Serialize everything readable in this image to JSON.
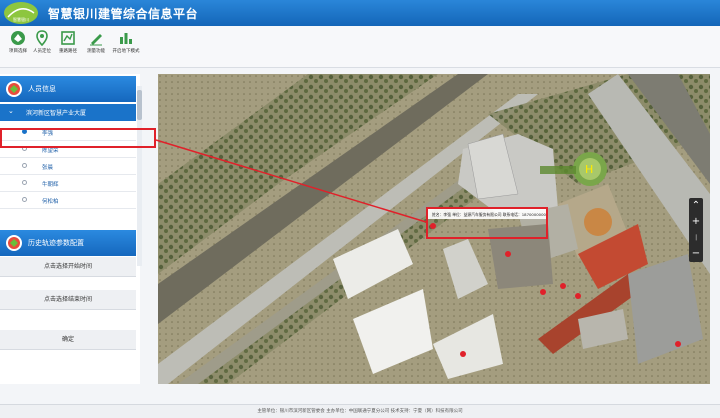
{
  "header": {
    "logo_text": "智慧银川",
    "title": "智慧银川建管综合信息平台"
  },
  "toolbar": {
    "items": [
      {
        "label": "项目选择",
        "icon": "project-select-icon"
      },
      {
        "label": "人员定位",
        "icon": "location-pin-icon"
      },
      {
        "label": "重路路径",
        "icon": "route-icon"
      },
      {
        "label": "测量功能",
        "icon": "measure-icon"
      },
      {
        "label": "开启地下模式",
        "icon": "underground-mode-icon"
      }
    ]
  },
  "sidebar": {
    "personnel_title": "人员信息",
    "group_label": "滨河新区智慧产业大厦",
    "people": [
      {
        "name": "李强",
        "selected": true
      },
      {
        "name": "陈望荣",
        "selected": false
      },
      {
        "name": "张晨",
        "selected": false
      },
      {
        "name": "牛朝辉",
        "selected": false
      },
      {
        "name": "何松柏",
        "selected": false
      }
    ],
    "history_title": "历史轨迹参数配置",
    "start_time_label": "点击选择开始时间",
    "end_time_label": "点击选择结束时间",
    "confirm_label": "确定"
  },
  "map": {
    "helipad_label": "H",
    "popup_text": "姓名：李强  单位：益源汽车服务有限公司  联系电话：18700000000",
    "zoom_in": "+",
    "zoom_out": "−"
  },
  "footer": {
    "text": "主管单位：银川市滨河新区管委会   主办单位：中国联通宁夏分公司   技术支持：宁夏（网）科技有限公司"
  },
  "colors": {
    "accent": "#1a73c9",
    "highlight": "#e0212a",
    "header": "#1466b8"
  }
}
